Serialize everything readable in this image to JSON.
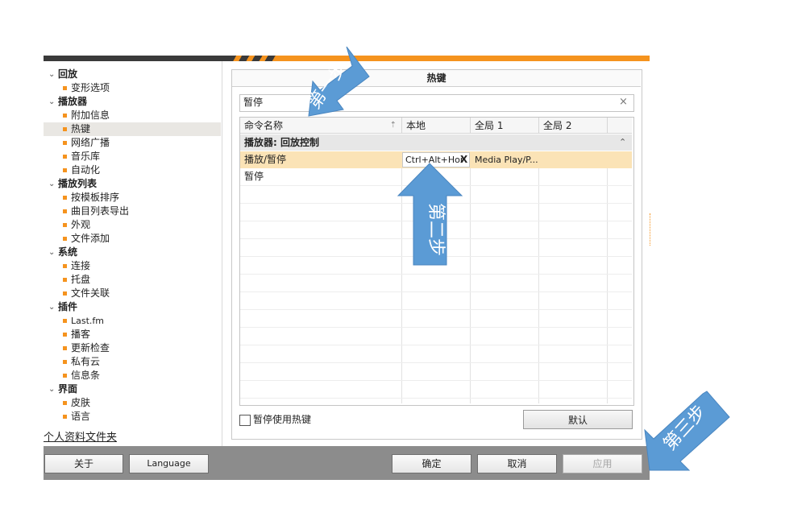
{
  "sidebar": {
    "categories": [
      {
        "label": "回放",
        "items": [
          "变形选项"
        ]
      },
      {
        "label": "播放器",
        "items": [
          "附加信息",
          "热键",
          "网络广播",
          "音乐库",
          "自动化"
        ]
      },
      {
        "label": "播放列表",
        "items": [
          "按模板排序",
          "曲目列表导出",
          "外观",
          "文件添加"
        ]
      },
      {
        "label": "系统",
        "items": [
          "连接",
          "托盘",
          "文件关联"
        ]
      },
      {
        "label": "插件",
        "items": [
          "Last.fm",
          "播客",
          "更新检查",
          "私有云",
          "信息条"
        ]
      },
      {
        "label": "界面",
        "items": [
          "皮肤",
          "语言"
        ]
      }
    ],
    "selected": "热键",
    "profile_link": "个人资料文件夹"
  },
  "panel": {
    "title": "热键",
    "search": {
      "value": "暂停",
      "clear": "×"
    },
    "table": {
      "columns": [
        "命令名称",
        "本地",
        "全局 1",
        "全局 2"
      ],
      "sort_indicator": "⇡",
      "group": {
        "label": "播放器: 回放控制",
        "toggle": "⌃"
      },
      "rows": [
        {
          "command": "播放/暂停",
          "local": "Ctrl+Alt+Hor",
          "global1": "Media Play/P...",
          "global2": "",
          "selected": true,
          "local_clear": "X"
        },
        {
          "command": "暂停",
          "local": "",
          "global1": "",
          "global2": "",
          "selected": false
        }
      ]
    },
    "disable_hotkeys_label": "暂停使用热键",
    "default_button": "默认"
  },
  "footer": {
    "about": "关于",
    "language": "Language",
    "ok": "确定",
    "cancel": "取消",
    "apply": "应用"
  },
  "annotations": {
    "step1": "第一步",
    "step2": "第二步",
    "step3": "第三步",
    "color": "#5b9bd5"
  },
  "colors": {
    "accent": "#f5931e",
    "selected_row": "#fbe3b6",
    "bottom_bar": "#8c8c8c"
  }
}
